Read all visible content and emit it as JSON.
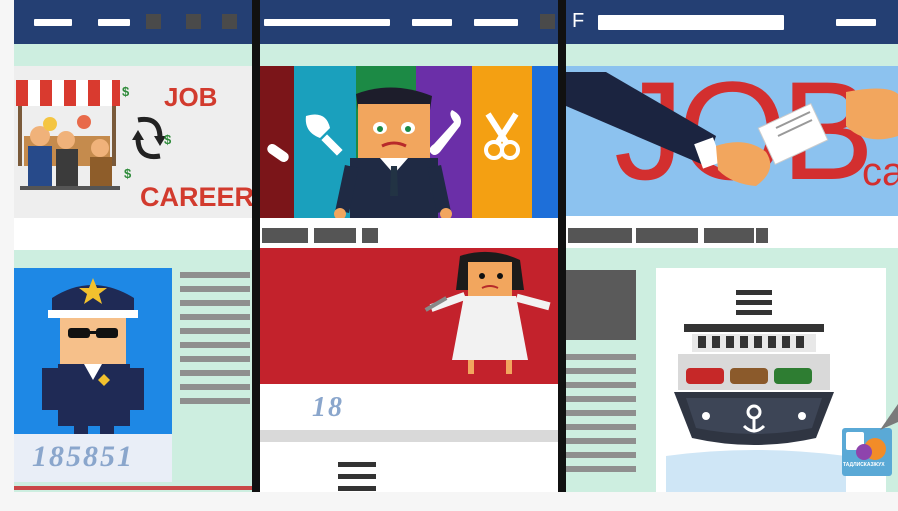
{
  "panel_left": {
    "job_label": "JOB",
    "career_label": "CAREER",
    "badge_number": "185851",
    "currency_symbol": "$"
  },
  "panel_middle": {
    "number": "18"
  },
  "panel_right": {
    "menu_letter": "F",
    "job_big": "JOB",
    "ca_partial": "ca",
    "watermark": "ТАДЛИСКАЗЖУХ"
  }
}
